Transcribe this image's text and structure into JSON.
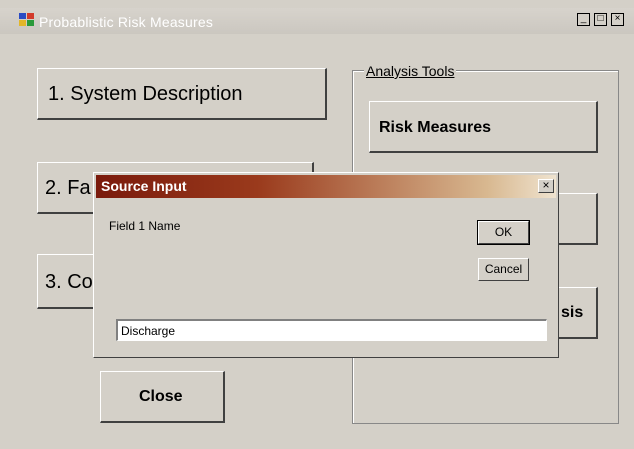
{
  "app": {
    "title": "Probablistic Risk Measures",
    "controls": {
      "minimize": "_",
      "maximize": "□",
      "close": "×"
    }
  },
  "main": {
    "buttons": {
      "system_description": "1. System Description",
      "fa_partial": "2. Fa",
      "co_partial": "3. Co",
      "close": "Close"
    },
    "analysis_tools": {
      "label": "Analysis Tools",
      "risk_measures": "Risk Measures",
      "analysis_partial": "sis"
    }
  },
  "dialog": {
    "title": "Source Input",
    "close_glyph": "×",
    "prompt": "Field 1  Name",
    "ok_label": "OK",
    "cancel_label": "Cancel",
    "input_value": "Discharge"
  },
  "colors": {
    "face": "#d4d0c8",
    "dialog_title_start": "#7a1a0c",
    "dialog_title_end": "#efe3cf"
  }
}
